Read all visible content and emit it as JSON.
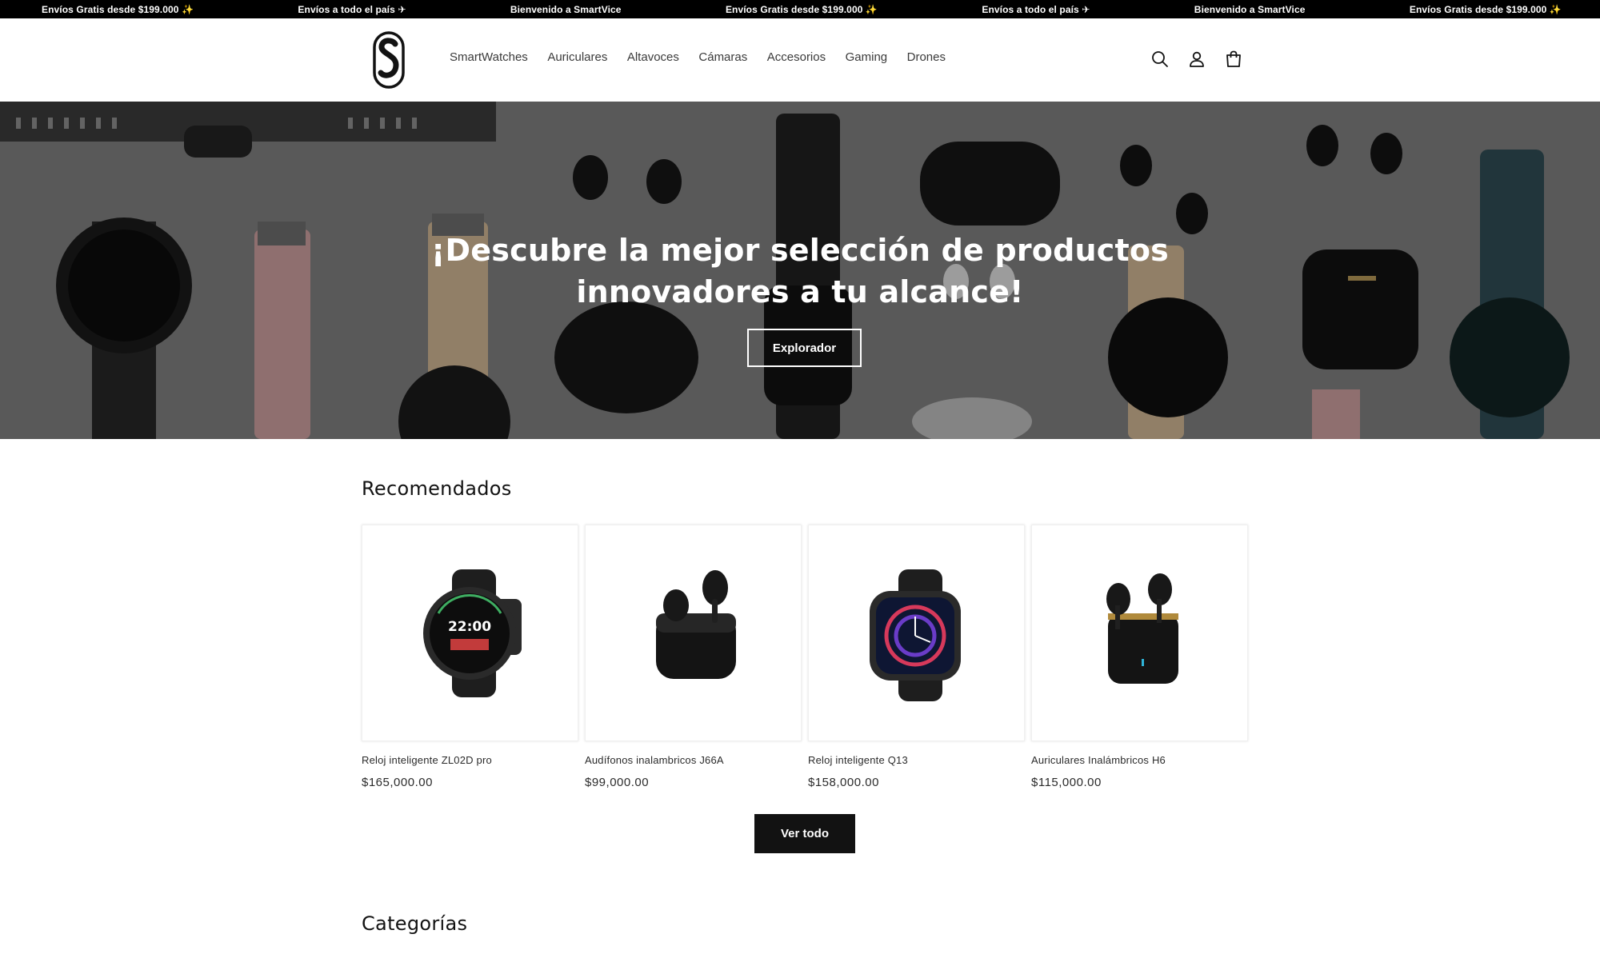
{
  "announcement": {
    "items": [
      "Envíos Gratis desde $199.000 ✨",
      "Envíos a todo el país ✈",
      "Bienvenido a SmartVice",
      "Envíos Gratis desde $199.000 ✨",
      "Envíos a todo el país ✈",
      "Bienvenido a SmartVice",
      "Envíos Gratis desde $199.000 ✨"
    ]
  },
  "header": {
    "logo_icon": "smartvice-s-logo",
    "nav": [
      "SmartWatches",
      "Auriculares",
      "Altavoces",
      "Cámaras",
      "Accesorios",
      "Gaming",
      "Drones"
    ],
    "icons": [
      "search-icon",
      "account-icon",
      "cart-icon"
    ]
  },
  "hero": {
    "title_line1": "¡Descubre la mejor selección de productos",
    "title_line2": "innovadores a tu alcance!",
    "button": "Explorador"
  },
  "recommended": {
    "title": "Recomendados",
    "products": [
      {
        "name": "Reloj inteligente ZL02D pro",
        "price": "$165,000.00",
        "image": "round-smartwatch"
      },
      {
        "name": "Audífonos inalambricos J66A",
        "price": "$99,000.00",
        "image": "earbuds-case"
      },
      {
        "name": "Reloj inteligente Q13",
        "price": "$158,000.00",
        "image": "square-smartwatch"
      },
      {
        "name": "Auriculares Inalámbricos H6",
        "price": "$115,000.00",
        "image": "earbuds-case-open"
      }
    ],
    "view_all": "Ver todo"
  },
  "categories": {
    "title": "Categorías"
  },
  "colors": {
    "accent": "#121212",
    "announce_bg": "#000000",
    "hero_overlay": "#7a7a7a"
  }
}
